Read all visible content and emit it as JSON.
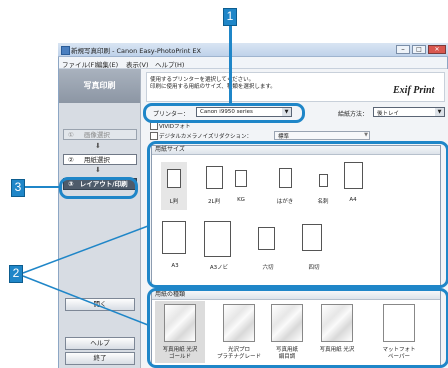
{
  "title_bar": {
    "title": "新規写真印刷 - Canon Easy-PhotoPrint EX"
  },
  "menu": [
    "ファイル(F)",
    "編集(E)",
    "表示(V)",
    "ヘルプ(H)"
  ],
  "sidebar": {
    "header": "写真印刷",
    "steps": [
      {
        "num": "①",
        "label": "画像選択"
      },
      {
        "num": "②",
        "label": "用紙選択"
      },
      {
        "num": "③",
        "label": "レイアウト/印刷"
      }
    ],
    "bottom_button": "開く",
    "help_button": "ヘルプ",
    "exit_button": "終了"
  },
  "instructions": {
    "line1": "使用するプリンターを選択してください。",
    "line2": "印刷に使用する用紙のサイズ、種類を選択します。"
  },
  "brand": "Exif Print",
  "printer": {
    "label": "プリンター：",
    "value": "Canon i9950 series"
  },
  "feed": {
    "label": "給紙方法：",
    "value": "後トレイ"
  },
  "options": {
    "vivid": "VIVIDフォト",
    "correction_label": "デジタルカメラノイズリダクション：",
    "correction_value": "標準"
  },
  "paper_size": {
    "header": "用紙サイズ",
    "items": [
      "L判",
      "2L判",
      "KG",
      "はがき",
      "名刺",
      "A4",
      "A3",
      "A3ノビ",
      "六切",
      "四切"
    ]
  },
  "paper_type": {
    "header": "用紙の種類",
    "items": [
      {
        "l1": "写真用紙 光沢",
        "l2": "ゴールド"
      },
      {
        "l1": "光沢プロ",
        "l2": "プラチナグレード"
      },
      {
        "l1": "写真用紙",
        "l2": "絹目調"
      },
      {
        "l1": "写真用紙 光沢",
        "l2": ""
      },
      {
        "l1": "マットフォト",
        "l2": "ペーパー"
      }
    ]
  },
  "callouts": {
    "c1": "1",
    "c2": "2",
    "c3": "3"
  },
  "colors": {
    "accent": "#1f86c8",
    "window_bg": "#e8eef6"
  }
}
